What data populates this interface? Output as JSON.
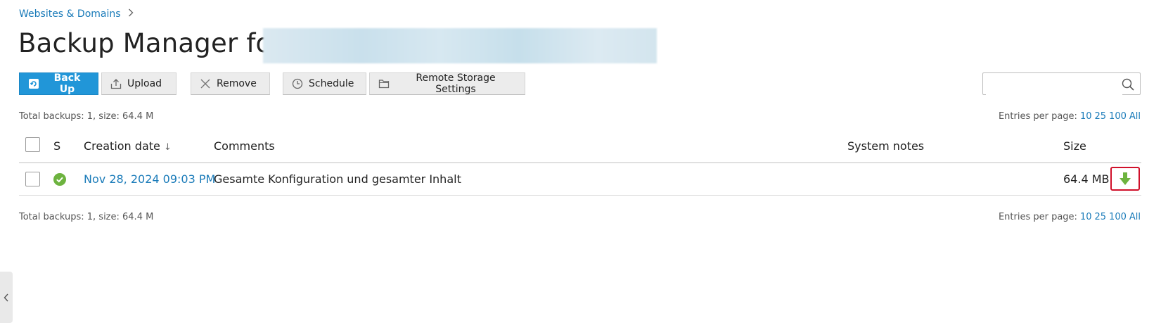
{
  "breadcrumb": {
    "items": [
      {
        "label": "Websites & Domains"
      }
    ]
  },
  "page": {
    "title": "Backup Manager for"
  },
  "toolbar": {
    "backup_label": "Back Up",
    "upload_label": "Upload",
    "remove_label": "Remove",
    "schedule_label": "Schedule",
    "remote_storage_label": "Remote Storage Settings"
  },
  "search": {
    "value": "",
    "placeholder": ""
  },
  "summary": {
    "total_top": "Total backups: 1, size: 64.4 M",
    "total_bottom": "Total backups: 1, size: 64.4 M",
    "entries_label": "Entries per page:",
    "entries_options": [
      "10",
      "25",
      "100",
      "All"
    ]
  },
  "table": {
    "headers": {
      "status": "S",
      "creation_date": "Creation date",
      "sort_indicator": "↓",
      "comments": "Comments",
      "system_notes": "System notes",
      "size": "Size"
    },
    "rows": [
      {
        "status": "success",
        "creation_date": "Nov 28, 2024 09:03 PM",
        "comments": "Gesamte Konfiguration und gesamter Inhalt",
        "system_notes": "",
        "size": "64.4 MB"
      }
    ]
  },
  "icons": {
    "breadcrumb_separator": "chevron-right-icon",
    "backup": "backup-icon",
    "upload": "upload-icon",
    "remove": "close-icon",
    "schedule": "clock-icon",
    "remote_storage": "folder-icon",
    "search": "search-icon",
    "status_ok": "check-circle-icon",
    "download": "download-arrow-icon",
    "collapse": "chevron-left-icon"
  },
  "colors": {
    "primary": "#2196d8",
    "link": "#1a7bb9",
    "success": "#6db33f",
    "highlight": "#d0102a"
  }
}
